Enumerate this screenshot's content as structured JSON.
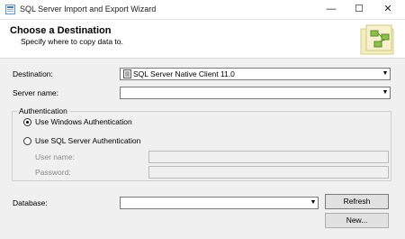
{
  "window": {
    "title": "SQL Server Import and Export Wizard",
    "minimize": "—",
    "maximize": "☐",
    "close": "✕"
  },
  "header": {
    "title": "Choose a Destination",
    "subtitle": "Specify where to copy data to."
  },
  "destination": {
    "label": "Destination:",
    "value": "SQL Server Native Client 11.0",
    "icon": "database-provider-icon"
  },
  "server": {
    "label": "Server name:",
    "value": ""
  },
  "authentication": {
    "group_label": "Authentication",
    "windows_label": "Use Windows Authentication",
    "sql_label": "Use SQL Server Authentication",
    "selected": "windows",
    "username_label": "User name:",
    "username_value": "",
    "password_label": "Password:",
    "password_value": ""
  },
  "database": {
    "label": "Database:",
    "value": "",
    "refresh_label": "Refresh",
    "new_label": "New..."
  }
}
